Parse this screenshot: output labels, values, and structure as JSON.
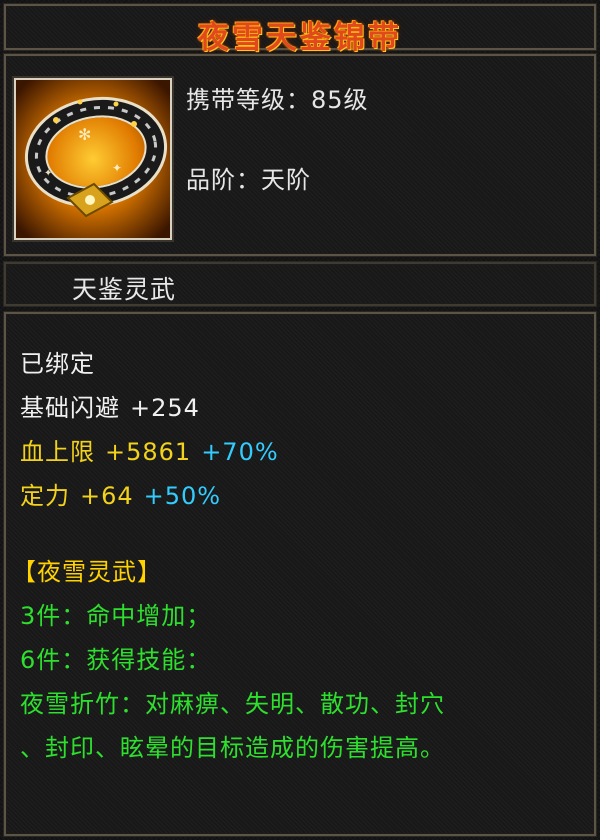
{
  "item": {
    "name": "夜雪天鉴锦带",
    "level_label": "携带等级：",
    "level_value": "85级",
    "grade_label": "品阶：",
    "grade_value": "天阶",
    "set_name": "天鉴灵武",
    "icon": "belt-icon"
  },
  "stats": {
    "bound": "已绑定",
    "dodge_label": "基础闪避",
    "dodge_value": "+254",
    "hp_label": "血上限",
    "hp_value": "+5861",
    "hp_bonus": "+70%",
    "focus_label": "定力",
    "focus_value": "+64",
    "focus_bonus": "+50%"
  },
  "set_bonus": {
    "header": "【夜雪灵武】",
    "tier3": "3件：命中增加；",
    "tier6": "6件：获得技能：",
    "skill_line1": "夜雪折竹：对麻痹、失明、散功、封穴",
    "skill_line2": "、封印、眩晕的目标造成的伤害提高。"
  },
  "colors": {
    "title": "#e0481e",
    "yellow": "#f2d21a",
    "cyan": "#33ccff",
    "green": "#2ee02e",
    "gold": "#ffd200"
  }
}
